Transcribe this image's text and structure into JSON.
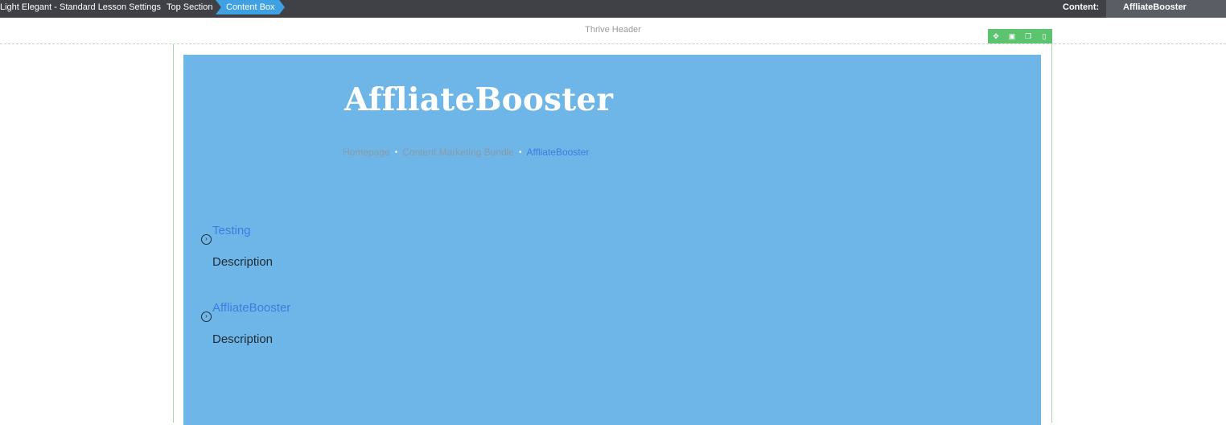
{
  "topbar": {
    "breadcrumbs": [
      "Light Elegant - Standard Lesson Settings",
      "Top Section",
      "Content Box"
    ],
    "content_label": "Content:",
    "content_value": "AffliateBooster"
  },
  "header": {
    "label": "Thrive Header"
  },
  "toolbar": {
    "icons": [
      "move-icon",
      "save-icon",
      "duplicate-icon",
      "delete-icon"
    ]
  },
  "content": {
    "title": "AffliateBooster",
    "breadcrumbs": {
      "home": "Homepage",
      "parent": "Content Marketing Bundle",
      "current": "AffliateBooster",
      "separator": "•"
    },
    "items": [
      {
        "title": "Testing",
        "description": "Description"
      },
      {
        "title": "AffliateBooster",
        "description": "Description"
      }
    ]
  },
  "colors": {
    "topbar": "#3f4146",
    "active_crumb": "#3fa0e2",
    "content_box": "#6fb6e8",
    "toolbar": "#5cc46e",
    "link": "#3b7de0"
  }
}
